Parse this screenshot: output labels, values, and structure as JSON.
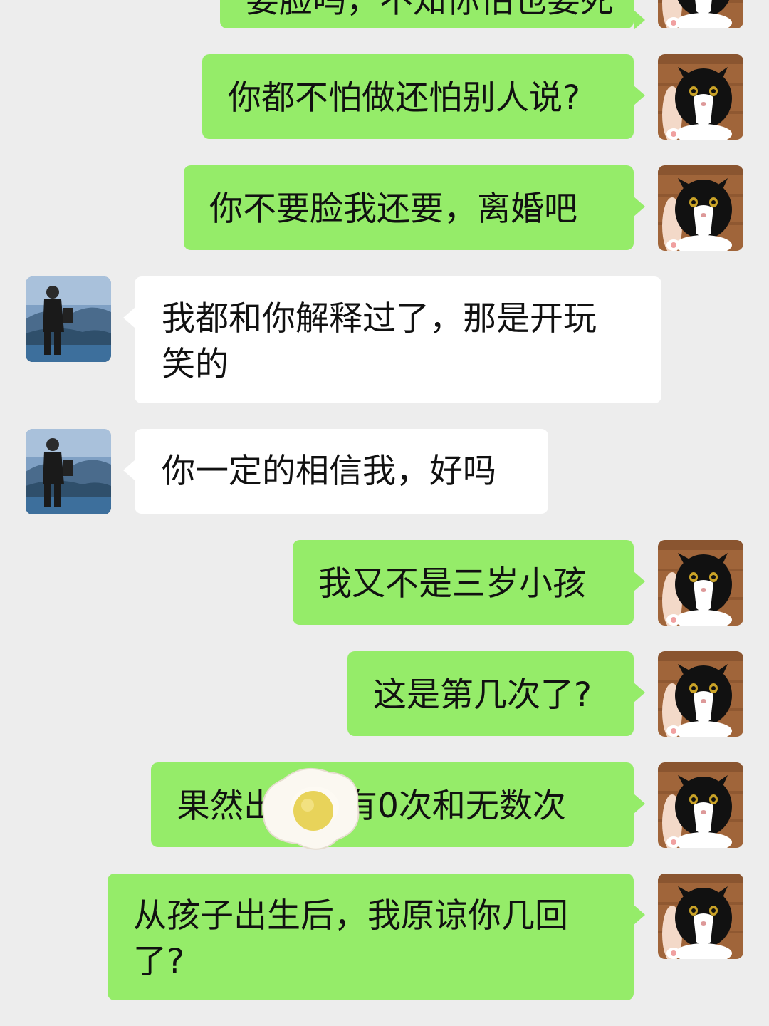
{
  "conversation": {
    "messages": [
      {
        "side": "me",
        "text": "要脸吗，不知你怕也要死"
      },
      {
        "side": "me",
        "text": "你都不怕做还怕别人说?"
      },
      {
        "side": "me",
        "text": "你不要脸我还要，离婚吧"
      },
      {
        "side": "them",
        "text": "我都和你解释过了，那是开玩\n笑的"
      },
      {
        "side": "them",
        "text": "你一定的相信我，好吗"
      },
      {
        "side": "me",
        "text": "我又不是三岁小孩"
      },
      {
        "side": "me",
        "text": "这是第几次了?"
      },
      {
        "side": "me",
        "text": "果然出轨只有0次和无数次"
      },
      {
        "side": "me",
        "text": "从孩子出生后，我原谅你几回\n了?"
      }
    ]
  },
  "avatars": {
    "me": {
      "icon": "cat-avatar"
    },
    "them": {
      "icon": "man-hiking-avatar"
    }
  },
  "sticker": {
    "icon": "fried-egg-sticker"
  },
  "colors": {
    "background": "#ededed",
    "my_bubble": "#95ec69",
    "their_bubble": "#ffffff"
  }
}
